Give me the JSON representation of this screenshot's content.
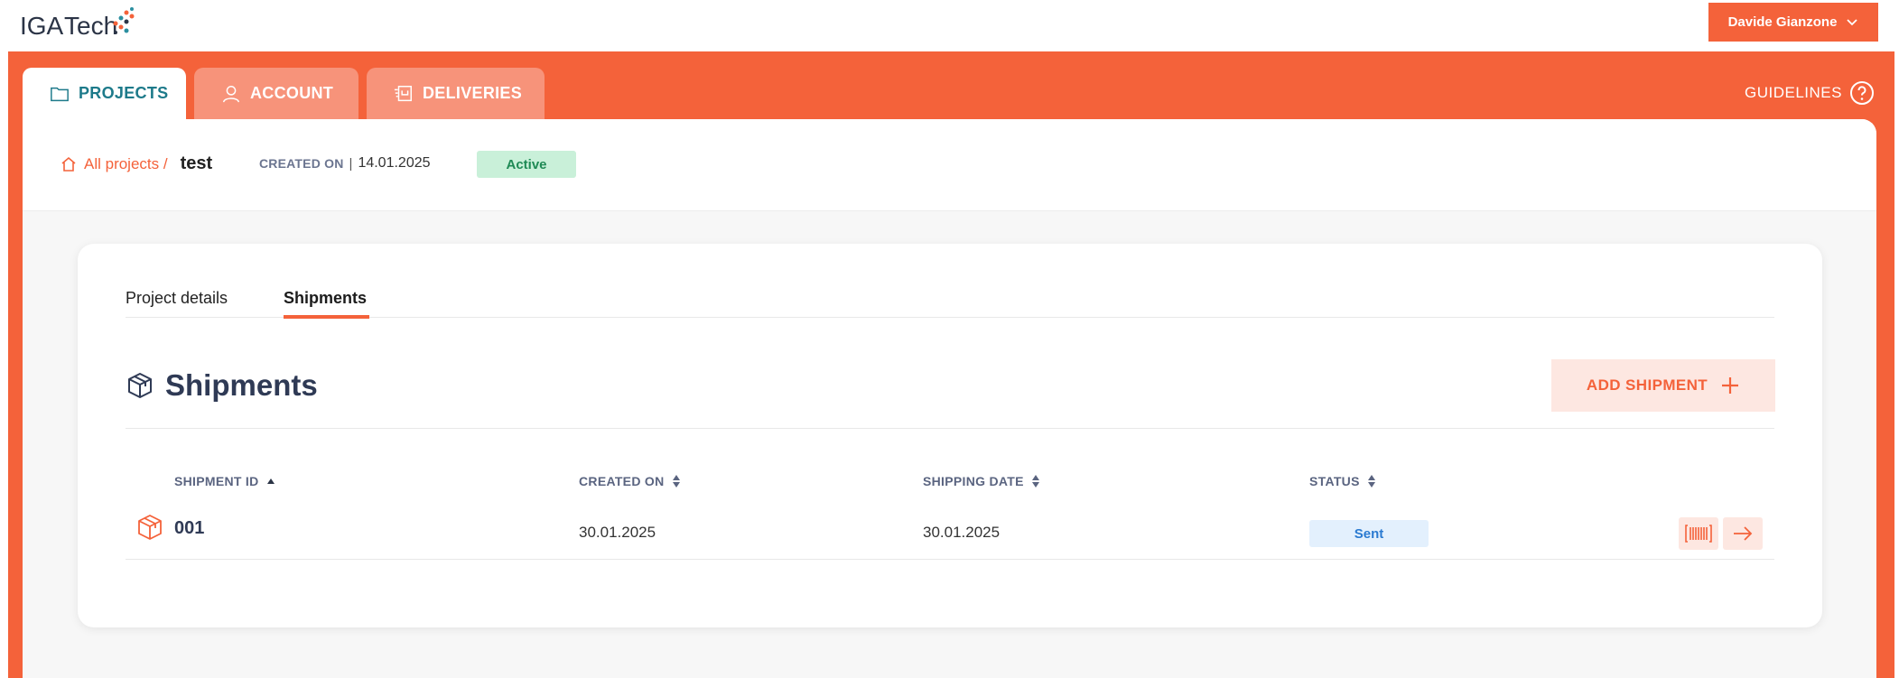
{
  "brand": {
    "logo_text_main": "IGA",
    "logo_text_rest": "Tech"
  },
  "user": {
    "name": "Davide Gianzone"
  },
  "tabs": [
    {
      "label": "PROJECTS",
      "icon": "folder-icon"
    },
    {
      "label": "ACCOUNT",
      "icon": "user-icon"
    },
    {
      "label": "DELIVERIES",
      "icon": "delivery-icon"
    }
  ],
  "guidelines": {
    "label": "GUIDELINES",
    "icon": "help-circle-icon"
  },
  "breadcrumb": {
    "root": "All projects /",
    "current": "test"
  },
  "project": {
    "created_label": "CREATED ON",
    "separator": "|",
    "created_value": "14.01.2025",
    "status": "Active"
  },
  "subtabs": {
    "details": "Project details",
    "shipments": "Shipments"
  },
  "section": {
    "title": "Shipments",
    "add_label": "ADD SHIPMENT"
  },
  "table": {
    "headers": [
      "SHIPMENT ID",
      "CREATED ON",
      "SHIPPING DATE",
      "STATUS"
    ],
    "rows": [
      {
        "id": "001",
        "created_on": "30.01.2025",
        "shipping_date": "30.01.2025",
        "status": "Sent"
      }
    ]
  },
  "colors": {
    "accent": "#f4623a",
    "teal": "#1d7a8a",
    "active_bg": "#c9f0d9",
    "sent_bg": "#e3f0fd"
  }
}
